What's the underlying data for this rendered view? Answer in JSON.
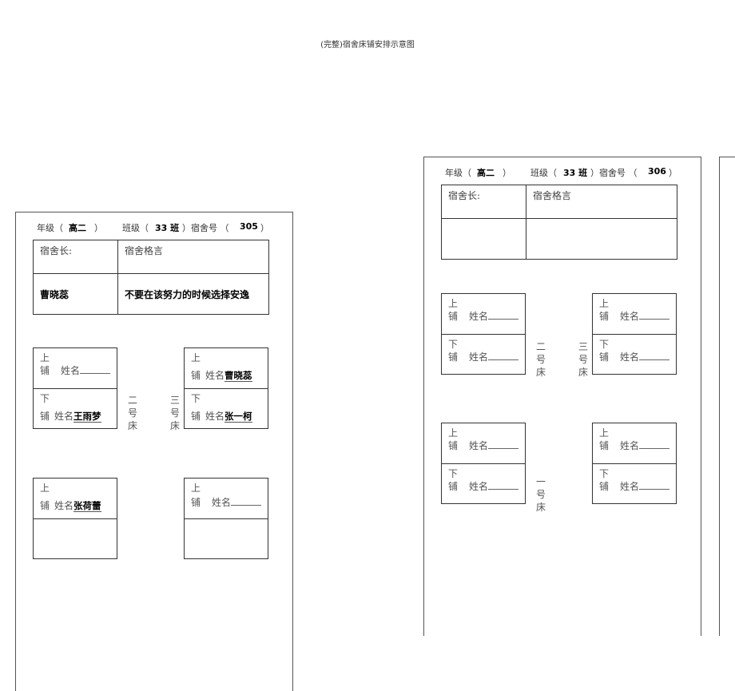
{
  "document": {
    "title": "(完整)宿舍床铺安排示意图"
  },
  "labels": {
    "grade": "年级（",
    "class": "班级（",
    "close_paren": "）",
    "close_paren_room": "）宿舍号 （",
    "leader": "宿舍长:",
    "motto": "宿舍格言",
    "upper": "上",
    "lower": "下",
    "bunk": "铺",
    "name": "姓名",
    "bed_2": [
      "二",
      "号",
      "床"
    ],
    "bed_3": [
      "三",
      "号",
      "床"
    ],
    "bed_1": [
      "一",
      "号",
      "床"
    ]
  },
  "panels": [
    {
      "grade": "高二",
      "class": "33 班",
      "room": "305",
      "leader_name": "曹晓蕊",
      "motto_text": "不要在该努力的时候选择安逸",
      "beds": {
        "row1_left": {
          "upper": "",
          "lower": "王雨梦"
        },
        "row1_right": {
          "upper": "曹晓蕊",
          "lower": "张一柯"
        },
        "row2_left": {
          "upper": "张荷蕾"
        },
        "row2_right": {
          "upper": ""
        }
      }
    },
    {
      "grade": "高二",
      "class": "33 班",
      "room": "306",
      "leader_name": "",
      "motto_text": "",
      "beds": {
        "row1_left": {
          "upper": "",
          "lower": ""
        },
        "row1_right": {
          "upper": "",
          "lower": ""
        },
        "row2_left": {
          "upper": "",
          "lower": ""
        },
        "row2_right": {
          "upper": "",
          "lower": ""
        }
      }
    }
  ]
}
